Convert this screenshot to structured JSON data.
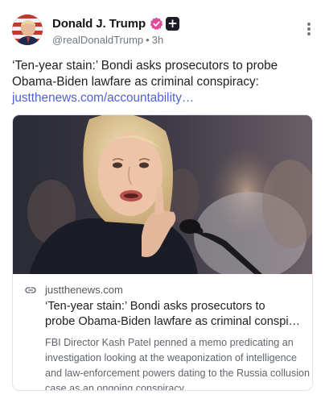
{
  "author": {
    "name": "Donald J. Trump",
    "handle": "@realDonaldTrump",
    "separator": "•",
    "time": "3h",
    "avatar_icon": "flag-portrait-avatar",
    "verified_icon": "verified-check-icon",
    "badge_icon": "plus-badge-icon",
    "plus": "+"
  },
  "menu": {
    "icon": "more-vertical-icon"
  },
  "post": {
    "text": "‘Ten-year stain:’ Bondi asks prosecutors to probe Obama-Biden lawfare as criminal conspiracy:",
    "link_text": "justthenews.com/accountability…"
  },
  "card": {
    "domain": "justthenews.com",
    "title_line1": "‘Ten-year stain:’ Bondi asks prosecutors to",
    "title_line2": "probe Obama-Biden lawfare as criminal conspi…",
    "description": "FBI Director Kash Patel penned a memo predicating an investigation looking at the weaponization of intelligence and law-enforcement powers dating to the Russia collusion case as an ongoing conspiracy.",
    "link_icon": "link-icon"
  },
  "colors": {
    "accent": "#4f5fd6",
    "verified": "#e24a9b",
    "muted": "#6e7880"
  }
}
